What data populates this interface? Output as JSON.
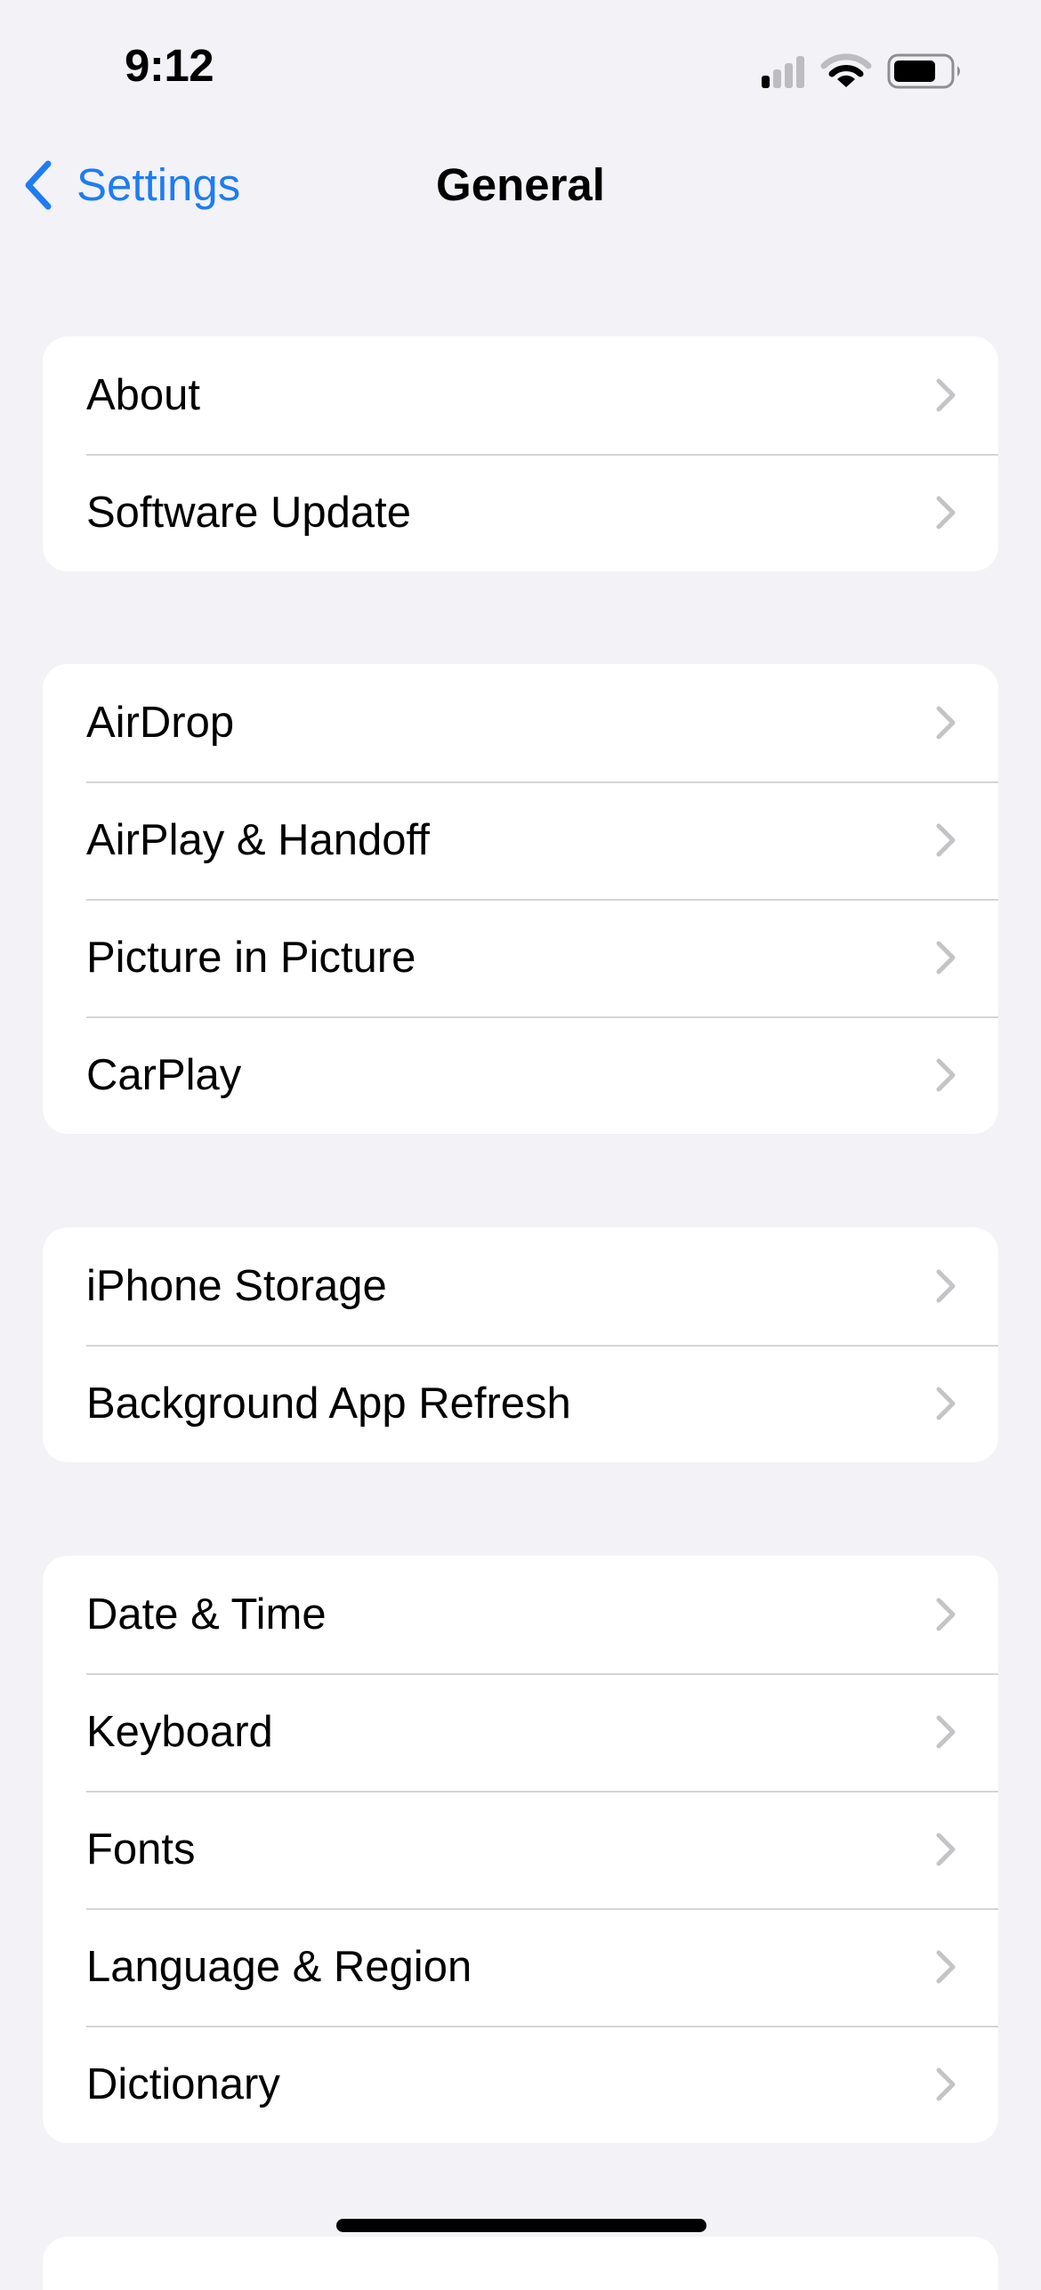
{
  "status_bar": {
    "time": "9:12",
    "signal_icon": "cellular-signal-icon",
    "signal_bars_active": 1,
    "signal_bars_total": 4,
    "wifi_icon": "wifi-icon",
    "battery_icon": "battery-icon",
    "battery_level": 0.75
  },
  "nav": {
    "back_label": "Settings",
    "back_icon": "chevron-left-icon",
    "title": "General"
  },
  "colors": {
    "accent": "#1E7CF1",
    "background": "#F2F2F7",
    "card": "#FFFFFF",
    "chevron": "#C4C4C7",
    "separator": "#D4D4D8"
  },
  "groups": [
    {
      "items": [
        {
          "label": "About"
        },
        {
          "label": "Software Update"
        }
      ]
    },
    {
      "items": [
        {
          "label": "AirDrop"
        },
        {
          "label": "AirPlay & Handoff"
        },
        {
          "label": "Picture in Picture"
        },
        {
          "label": "CarPlay"
        }
      ]
    },
    {
      "items": [
        {
          "label": "iPhone Storage"
        },
        {
          "label": "Background App Refresh"
        }
      ]
    },
    {
      "items": [
        {
          "label": "Date & Time"
        },
        {
          "label": "Keyboard"
        },
        {
          "label": "Fonts"
        },
        {
          "label": "Language & Region"
        },
        {
          "label": "Dictionary"
        }
      ]
    }
  ]
}
